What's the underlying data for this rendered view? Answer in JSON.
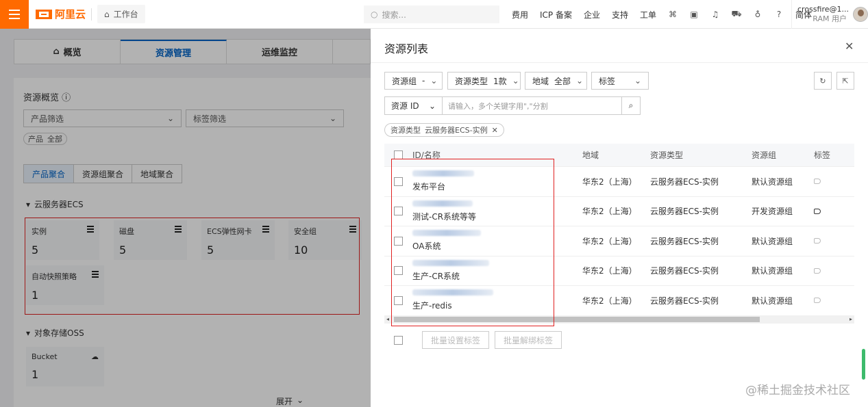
{
  "topbar": {
    "logo": "阿里云",
    "workbench": "工作台",
    "search_placeholder": "搜索...",
    "nav": [
      "费用",
      "ICP 备案",
      "企业",
      "支持",
      "工单"
    ],
    "lang": "简体",
    "user_name": "crossfire@1...",
    "user_type": "RAM 用户"
  },
  "bg": {
    "tabs": [
      "概览",
      "资源管理",
      "运维监控"
    ],
    "overview_title": "资源概览",
    "product_filter": "产品筛选",
    "tag_filter": "标签筛选",
    "product_pill": {
      "label": "产品",
      "value": "全部"
    },
    "seg": [
      "产品聚合",
      "资源组聚合",
      "地域聚合"
    ],
    "ecs_group": "云服务器ECS",
    "ecs_cards": [
      {
        "label": "实例",
        "value": "5"
      },
      {
        "label": "磁盘",
        "value": "5"
      },
      {
        "label": "ECS弹性网卡",
        "value": "5"
      },
      {
        "label": "安全组",
        "value": "10"
      },
      {
        "label": "自动快照策略",
        "value": "1"
      }
    ],
    "oss_group": "对象存储OSS",
    "oss_cards": [
      {
        "label": "Bucket",
        "value": "1"
      }
    ],
    "expand": "展开"
  },
  "drawer": {
    "title": "资源列表",
    "filters": {
      "resource_group": {
        "label": "资源组",
        "value": "-"
      },
      "resource_type": {
        "label": "资源类型",
        "value": "1款"
      },
      "region": {
        "label": "地域",
        "value": "全部"
      },
      "tag": {
        "label": "标签"
      }
    },
    "id_select": "资源 ID",
    "id_placeholder": "请输入，多个关键字用\",\"分割",
    "chip": {
      "label": "资源类型",
      "value": "云服务器ECS-实例"
    },
    "columns": [
      "ID/名称",
      "地域",
      "资源类型",
      "资源组",
      "标签"
    ],
    "rows": [
      {
        "name": "发布平台",
        "region": "华东2（上海）",
        "type": "云服务器ECS-实例",
        "group": "默认资源组"
      },
      {
        "name": "测试-CR系统等等",
        "region": "华东2（上海）",
        "type": "云服务器ECS-实例",
        "group": "开发资源组"
      },
      {
        "name": "OA系统",
        "region": "华东2（上海）",
        "type": "云服务器ECS-实例",
        "group": "默认资源组"
      },
      {
        "name": "生产-CR系统",
        "region": "华东2（上海）",
        "type": "云服务器ECS-实例",
        "group": "默认资源组"
      },
      {
        "name": "生产-redis",
        "region": "华东2（上海）",
        "type": "云服务器ECS-实例",
        "group": "默认资源组"
      }
    ],
    "batch_set_tag": "批量设置标签",
    "batch_unset_tag": "批量解绑标签"
  },
  "watermark": "@稀土掘金技术社区",
  "colors": {
    "brand": "#ff6a00",
    "primary": "#0064c8",
    "highlight": "#e02020"
  }
}
